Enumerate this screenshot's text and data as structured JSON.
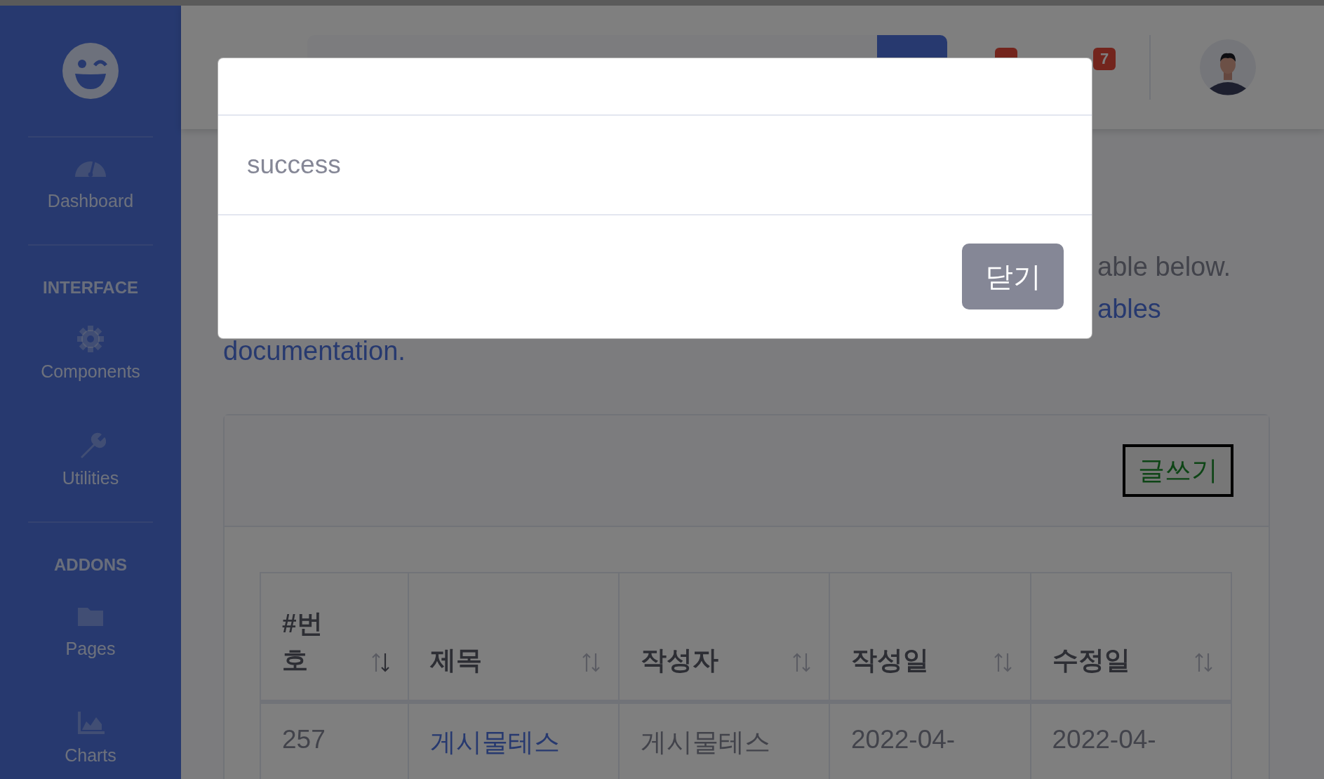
{
  "sidebar": {
    "sections": [
      {
        "items": [
          {
            "label": "Dashboard"
          }
        ]
      },
      {
        "heading": "INTERFACE",
        "items": [
          {
            "label": "Components"
          },
          {
            "label": "Utilities"
          }
        ]
      },
      {
        "heading": "ADDONS",
        "items": [
          {
            "label": "Pages"
          },
          {
            "label": "Charts"
          }
        ]
      }
    ]
  },
  "topbar": {
    "alerts": [
      {
        "count": "7"
      }
    ]
  },
  "page": {
    "intro_lines": [
      {
        "text": "able below.",
        "link": false
      },
      {
        "text": "ables",
        "link": true
      },
      {
        "text": "documentation.",
        "link": true
      }
    ]
  },
  "card": {
    "write_button": "글쓰기",
    "table": {
      "columns": [
        "#번호",
        "제목",
        "작성자",
        "작성일",
        "수정일"
      ],
      "rows": [
        {
          "cells": [
            "257",
            "게시물테스",
            "게시물테스",
            "2022-04-",
            "2022-04-"
          ]
        }
      ]
    }
  },
  "modal": {
    "body": "success",
    "buttons": [
      {
        "label": "닫기"
      }
    ]
  }
}
